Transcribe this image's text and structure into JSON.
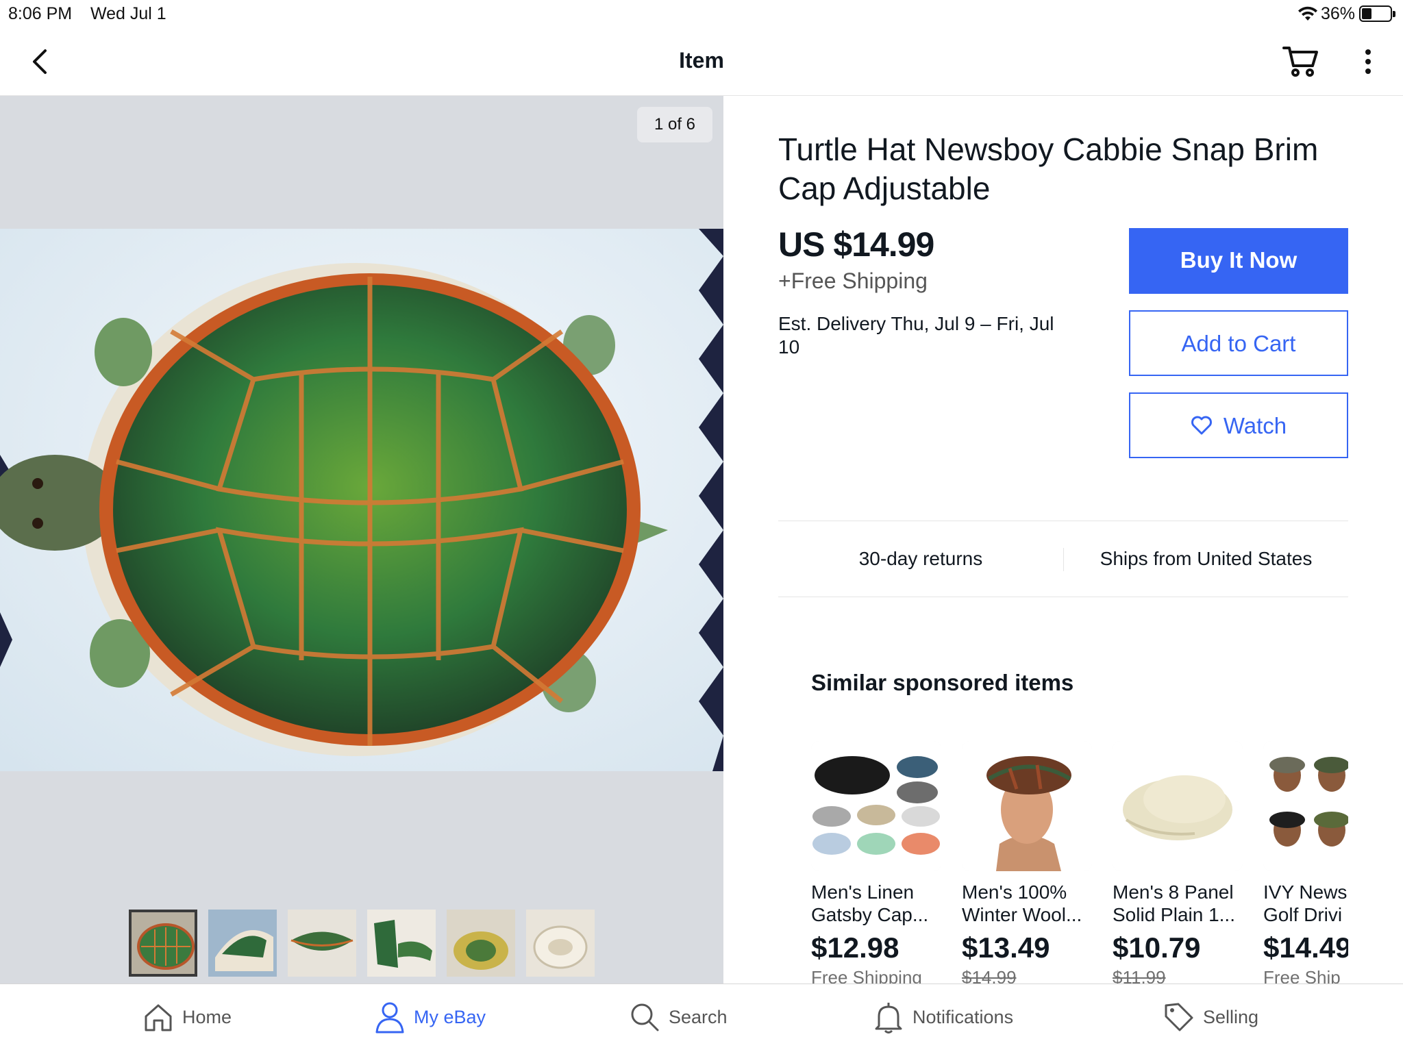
{
  "status_bar": {
    "time": "8:06 PM",
    "date": "Wed Jul 1",
    "battery": "36%"
  },
  "nav": {
    "title": "Item"
  },
  "gallery": {
    "counter": "1 of 6",
    "thumbnail_count": 6
  },
  "item": {
    "title": "Turtle Hat Newsboy Cabbie Snap Brim Cap Adjustable",
    "price": "US $14.99",
    "shipping": "+Free Shipping",
    "delivery_prefix": "Est. Delivery",
    "delivery_dates": "Thu, Jul 9 – Fri, Jul 10"
  },
  "actions": {
    "buy_now": "Buy It Now",
    "add_to_cart": "Add to Cart",
    "watch": "Watch"
  },
  "policies": {
    "returns": "30-day returns",
    "ships_from": "Ships from United States"
  },
  "similar": {
    "heading": "Similar sponsored items",
    "items": [
      {
        "title_line1": "Men's Linen",
        "title_line2": "Gatsby Cap...",
        "price": "$12.98",
        "sub": "Free Shipping"
      },
      {
        "title_line1": "Men's 100%",
        "title_line2": "Winter Wool...",
        "price": "$13.49",
        "sub": "$14.99"
      },
      {
        "title_line1": "Men's 8 Panel",
        "title_line2": "Solid Plain 1...",
        "price": "$10.79",
        "sub": "$11.99"
      },
      {
        "title_line1": "IVY News",
        "title_line2": "Golf Drivi",
        "price": "$14.49",
        "sub": "Free Ship"
      }
    ]
  },
  "tabs": [
    {
      "label": "Home",
      "icon": "home-icon"
    },
    {
      "label": "My eBay",
      "icon": "person-icon"
    },
    {
      "label": "Search",
      "icon": "search-icon"
    },
    {
      "label": "Notifications",
      "icon": "bell-icon"
    },
    {
      "label": "Selling",
      "icon": "tag-icon"
    }
  ],
  "colors": {
    "accent": "#3665f3",
    "text": "#111820",
    "image_bg": "#d8dbe0"
  }
}
